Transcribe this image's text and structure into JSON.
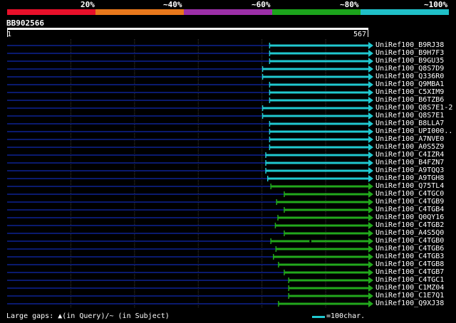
{
  "legend": [
    {
      "label": "20%",
      "color": "#e8102a"
    },
    {
      "label": "~40%",
      "color": "#e8781c"
    },
    {
      "label": "~60%",
      "color": "#9c2fa8"
    },
    {
      "label": "~80%",
      "color": "#1ca41c"
    },
    {
      "label": "~100%",
      "color": "#20c0c8"
    }
  ],
  "query": {
    "id": "BB902566",
    "start": "1",
    "end": "567",
    "length": 567
  },
  "colors": {
    "query_line": "#0a1a6e",
    "grid": "#3c3c3c",
    "teal": "#20c8d0",
    "green": "#22a81c"
  },
  "hits": [
    {
      "name": "UniRef100_B9RJ38",
      "start": 412,
      "color": "teal",
      "gap": false
    },
    {
      "name": "UniRef100_B9H7F3",
      "start": 412,
      "color": "teal",
      "gap": false
    },
    {
      "name": "UniRef100_B9GU35",
      "start": 412,
      "color": "teal",
      "gap": false
    },
    {
      "name": "UniRef100_Q8S7D9",
      "start": 401,
      "color": "teal",
      "gap": false
    },
    {
      "name": "UniRef100_Q336R0",
      "start": 401,
      "color": "teal",
      "gap": false
    },
    {
      "name": "UniRef100_Q9MBA1",
      "start": 412,
      "color": "teal",
      "gap": false
    },
    {
      "name": "UniRef100_C5XIM9",
      "start": 412,
      "color": "teal",
      "gap": false
    },
    {
      "name": "UniRef100_B6TZB6",
      "start": 412,
      "color": "teal",
      "gap": false
    },
    {
      "name": "UniRef100_Q8S7E1-2",
      "start": 401,
      "color": "teal",
      "gap": false
    },
    {
      "name": "UniRef100_Q8S7E1",
      "start": 401,
      "color": "teal",
      "gap": false
    },
    {
      "name": "UniRef100_B8LLA7",
      "start": 412,
      "color": "teal",
      "gap": false
    },
    {
      "name": "UniRef100_UPI000..",
      "start": 412,
      "color": "teal",
      "gap": false
    },
    {
      "name": "UniRef100_A7NVE0",
      "start": 412,
      "color": "teal",
      "gap": false
    },
    {
      "name": "UniRef100_A0S5Z9",
      "start": 412,
      "color": "teal",
      "gap": false
    },
    {
      "name": "UniRef100_C4IZR4",
      "start": 406,
      "color": "teal",
      "gap": false
    },
    {
      "name": "UniRef100_B4FZN7",
      "start": 406,
      "color": "teal",
      "gap": false
    },
    {
      "name": "UniRef100_A9TQQ3",
      "start": 406,
      "color": "teal",
      "gap": false
    },
    {
      "name": "UniRef100_A9TGH8",
      "start": 409,
      "color": "teal",
      "gap": false
    },
    {
      "name": "UniRef100_Q75TL4",
      "start": 414,
      "color": "green",
      "gap": false
    },
    {
      "name": "UniRef100_C4TGC0",
      "start": 435,
      "color": "green",
      "gap": false
    },
    {
      "name": "UniRef100_C4TGB9",
      "start": 423,
      "color": "green",
      "gap": false
    },
    {
      "name": "UniRef100_C4TGB4",
      "start": 435,
      "color": "green",
      "gap": false
    },
    {
      "name": "UniRef100_Q0QY16",
      "start": 425,
      "color": "green",
      "gap": false
    },
    {
      "name": "UniRef100_C4TGB2",
      "start": 421,
      "color": "green",
      "gap": false
    },
    {
      "name": "UniRef100_A4S5Q0",
      "start": 435,
      "color": "green",
      "gap": false
    },
    {
      "name": "UniRef100_C4TGB0",
      "start": 414,
      "color": "green",
      "gap": true
    },
    {
      "name": "UniRef100_C4TGB6",
      "start": 422,
      "color": "green",
      "gap": false
    },
    {
      "name": "UniRef100_C4TGB3",
      "start": 418,
      "color": "green",
      "gap": false
    },
    {
      "name": "UniRef100_C4TGB8",
      "start": 426,
      "color": "green",
      "gap": false
    },
    {
      "name": "UniRef100_C4TGB7",
      "start": 435,
      "color": "green",
      "gap": false
    },
    {
      "name": "UniRef100_C4TGC1",
      "start": 442,
      "color": "green",
      "gap": false
    },
    {
      "name": "UniRef100_C1MZ04",
      "start": 442,
      "color": "green",
      "gap": false
    },
    {
      "name": "UniRef100_C1E7Q1",
      "start": 442,
      "color": "green",
      "gap": false
    },
    {
      "name": "UniRef100_Q9XJ38",
      "start": 426,
      "color": "green",
      "gap": false
    }
  ],
  "footer": {
    "gaps_text": "Large gaps: ▲(in Query)/~ (in Subject)",
    "scale_text": "=100char."
  }
}
